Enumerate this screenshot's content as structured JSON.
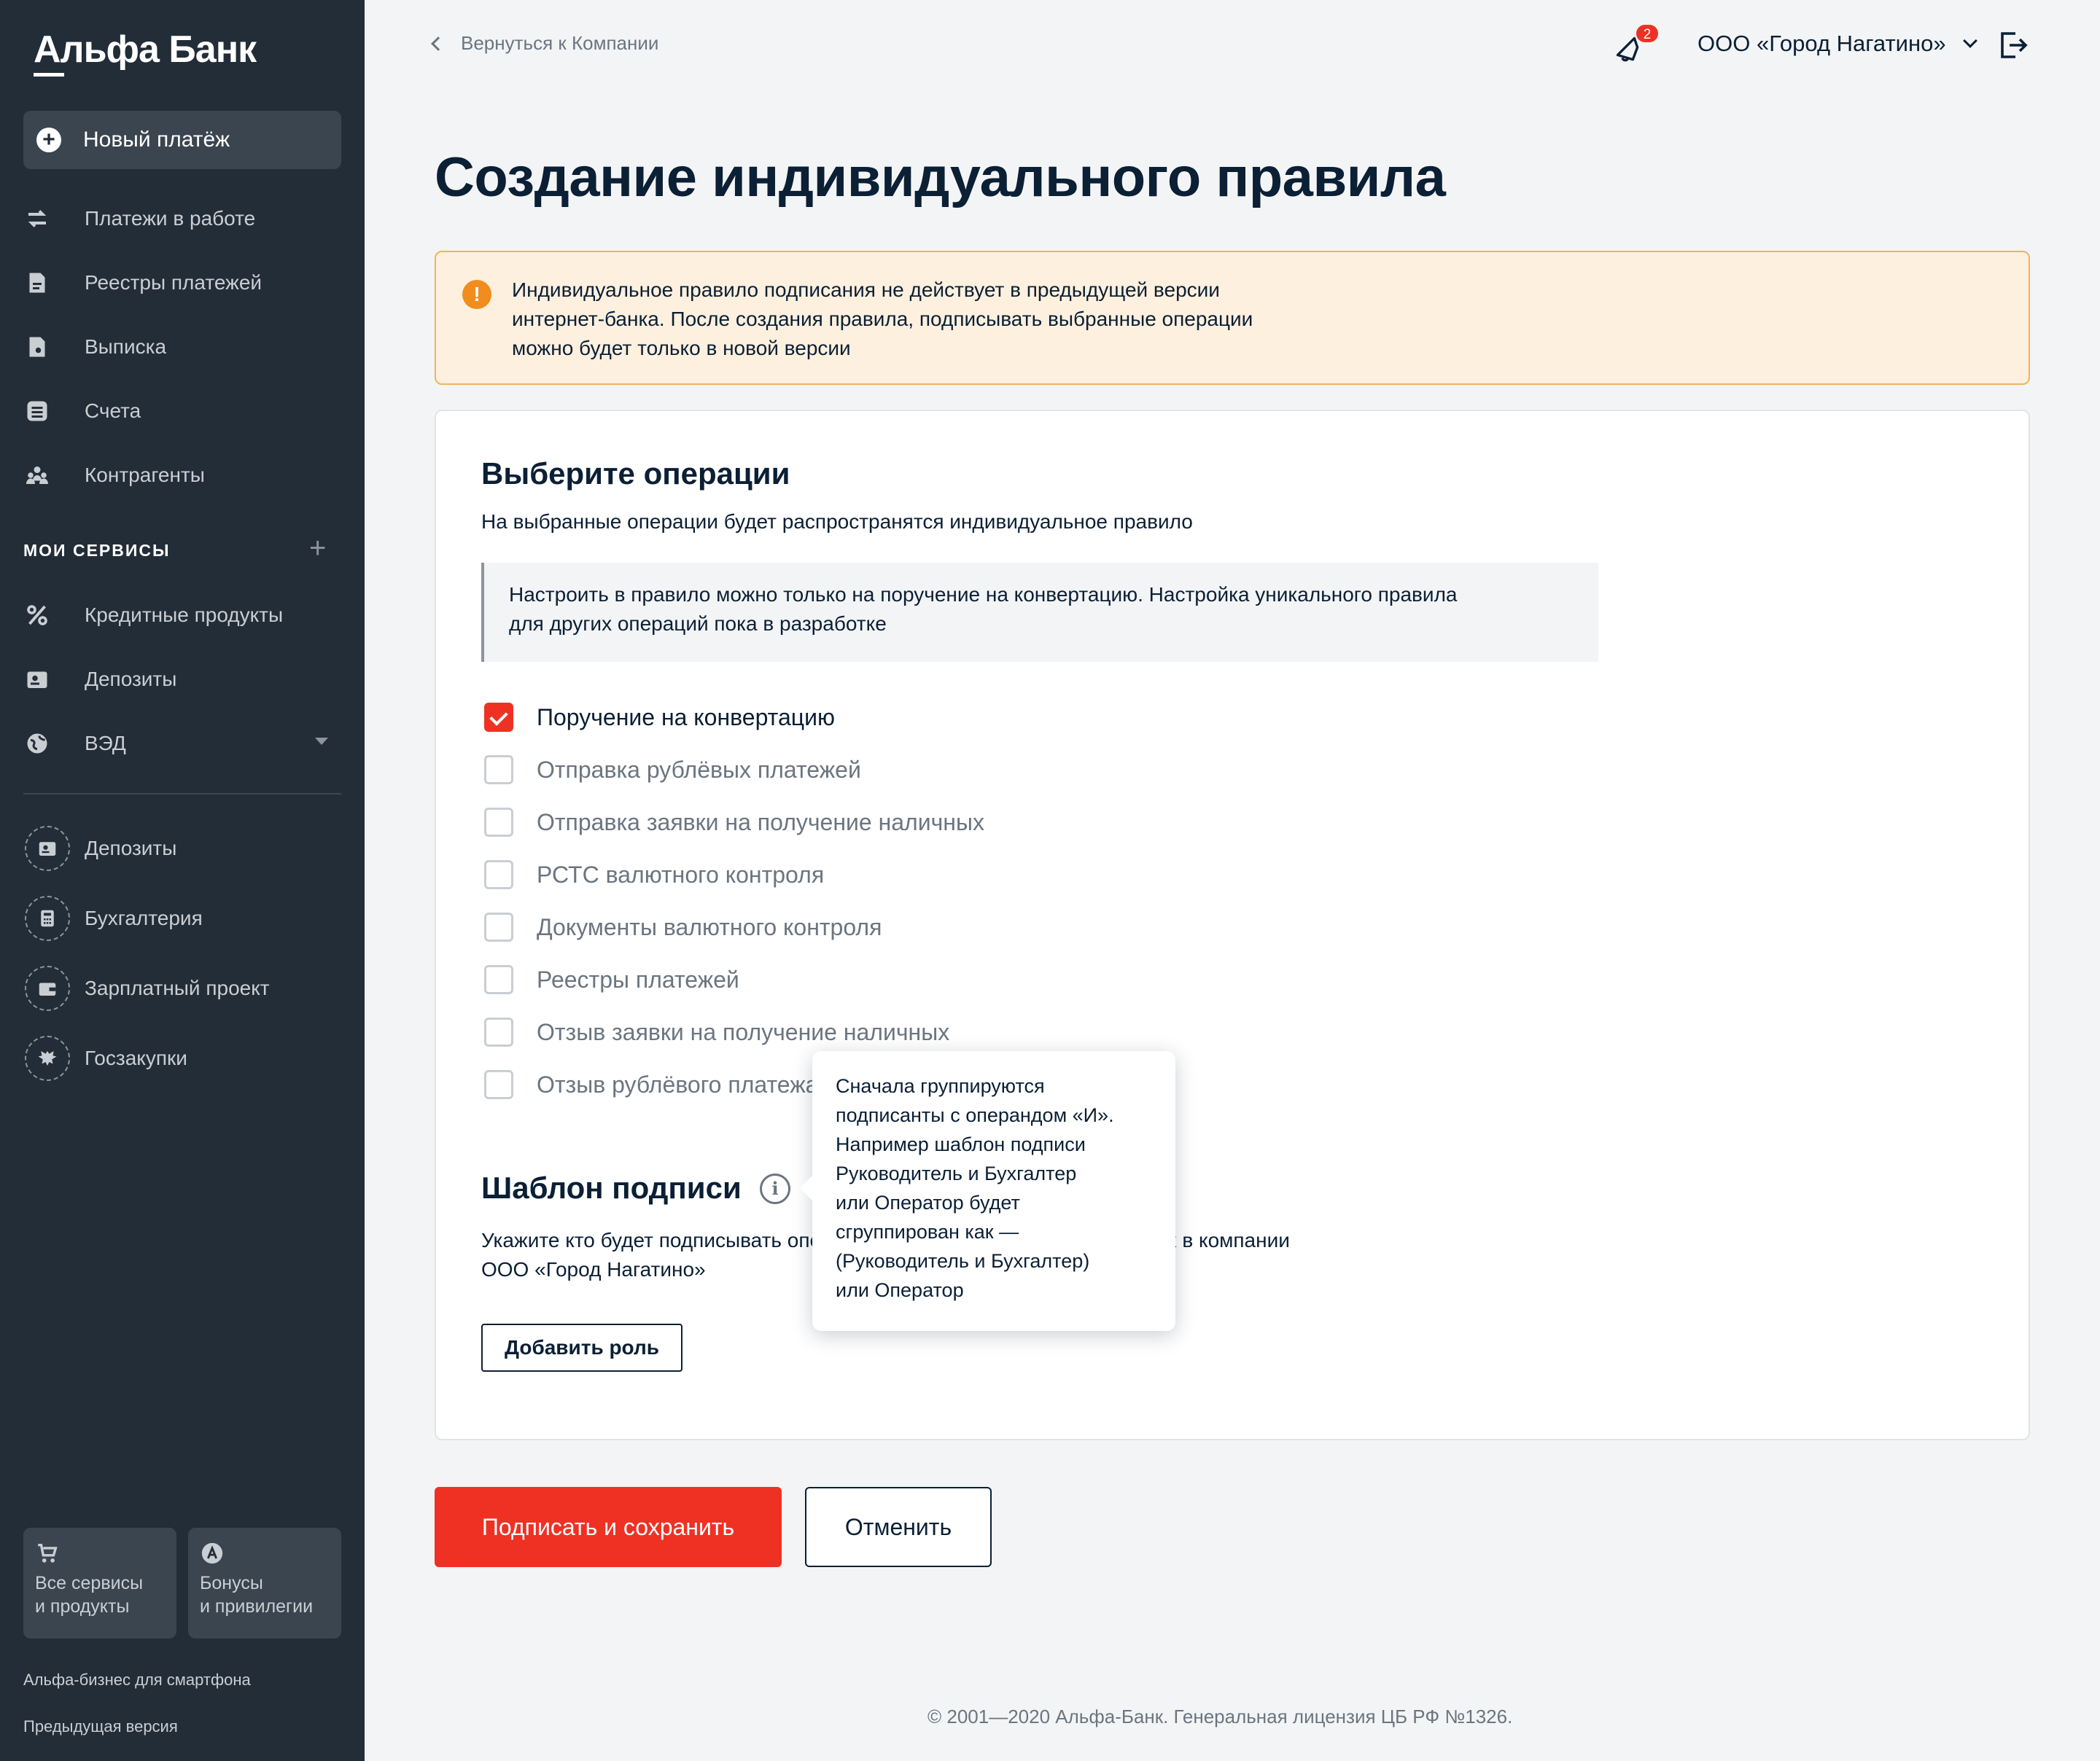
{
  "sidebar": {
    "logo": "Альфа Банк",
    "new_payment": "Новый платёж",
    "items": [
      {
        "label": "Платежи в работе",
        "icon": "exchange-icon"
      },
      {
        "label": "Реестры платежей",
        "icon": "registry-icon"
      },
      {
        "label": "Выписка",
        "icon": "statement-icon"
      },
      {
        "label": "Счета",
        "icon": "accounts-icon"
      },
      {
        "label": "Контрагенты",
        "icon": "contractors-icon"
      }
    ],
    "my_services_title": "МОИ СЕРВИСЫ",
    "services": [
      {
        "label": "Кредитные продукты",
        "icon": "percent-icon"
      },
      {
        "label": "Депозиты",
        "icon": "deposit-icon"
      },
      {
        "label": "ВЭД",
        "icon": "globe-icon"
      }
    ],
    "extra": [
      {
        "label": "Депозиты",
        "icon": "deposit-icon"
      },
      {
        "label": "Бухгалтерия",
        "icon": "calculator-icon"
      },
      {
        "label": "Зарплатный проект",
        "icon": "wallet-icon"
      },
      {
        "label": "Госзакупки",
        "icon": "eagle-icon"
      }
    ],
    "tiles": [
      {
        "line1": "Все сервисы",
        "line2": "и продукты"
      },
      {
        "line1": "Бонусы",
        "line2": "и привилегии"
      }
    ],
    "mobile_link": "Альфа-бизнес для смартфона",
    "prev_version": "Предыдущая версия"
  },
  "header": {
    "back": "Вернуться к Компании",
    "notifications_count": "2",
    "company": "ООО «Город Нагатино»"
  },
  "page_title": "Создание индивидуального правила",
  "warning": {
    "line1": "Индивидуальное правило подписания не действует в предыдущей версии",
    "line2": "интернет-банка. После создания правила, подписывать выбранные операции",
    "line3": "можно будет только в новой версии"
  },
  "operations": {
    "title": "Выберите операции",
    "subtitle": "На выбранные операции будет распространятся индивидуальное правило",
    "note_line1": "Настроить в правило можно только на поручение на конвертацию. Настройка уникального правила",
    "note_line2": "для других операций пока в разработке",
    "items": [
      {
        "label": "Поручение на конвертацию",
        "checked": true
      },
      {
        "label": "Отправка рублёвых платежей",
        "checked": false
      },
      {
        "label": "Отправка заявки на получение наличных",
        "checked": false
      },
      {
        "label": "РСТС валютного контроля",
        "checked": false
      },
      {
        "label": "Документы валютного контроля",
        "checked": false
      },
      {
        "label": "Реестры платежей",
        "checked": false
      },
      {
        "label": "Отзыв заявки на получение наличных",
        "checked": false
      },
      {
        "label": "Отзыв рублёвого платежа",
        "checked": false
      }
    ]
  },
  "template": {
    "title": "Шаблон подписи",
    "desc_line1": "Укажите кто будет подписывать операции из списка ролей, действующих в компании",
    "desc_line2": "ООО «Город Нагатино»",
    "add_role": "Добавить роль"
  },
  "tooltip": {
    "lines": [
      "Сначала группируются",
      "подписанты с операндом «И».",
      "Например шаблон подписи",
      "Руководитель и Бухгалтер",
      "или Оператор будет",
      "сгруппирован как —",
      "(Руководитель и Бухгалтер)",
      "или Оператор"
    ]
  },
  "actions": {
    "save": "Подписать и сохранить",
    "cancel": "Отменить"
  },
  "footer": "© 2001—2020 Альфа-Банк. Генеральная лицензия ЦБ РФ №1326.",
  "colors": {
    "brand_red": "#ef3124",
    "sidebar_bg": "#232d38",
    "warning_bg": "#fef0de",
    "warning_icon": "#f08d1e"
  }
}
